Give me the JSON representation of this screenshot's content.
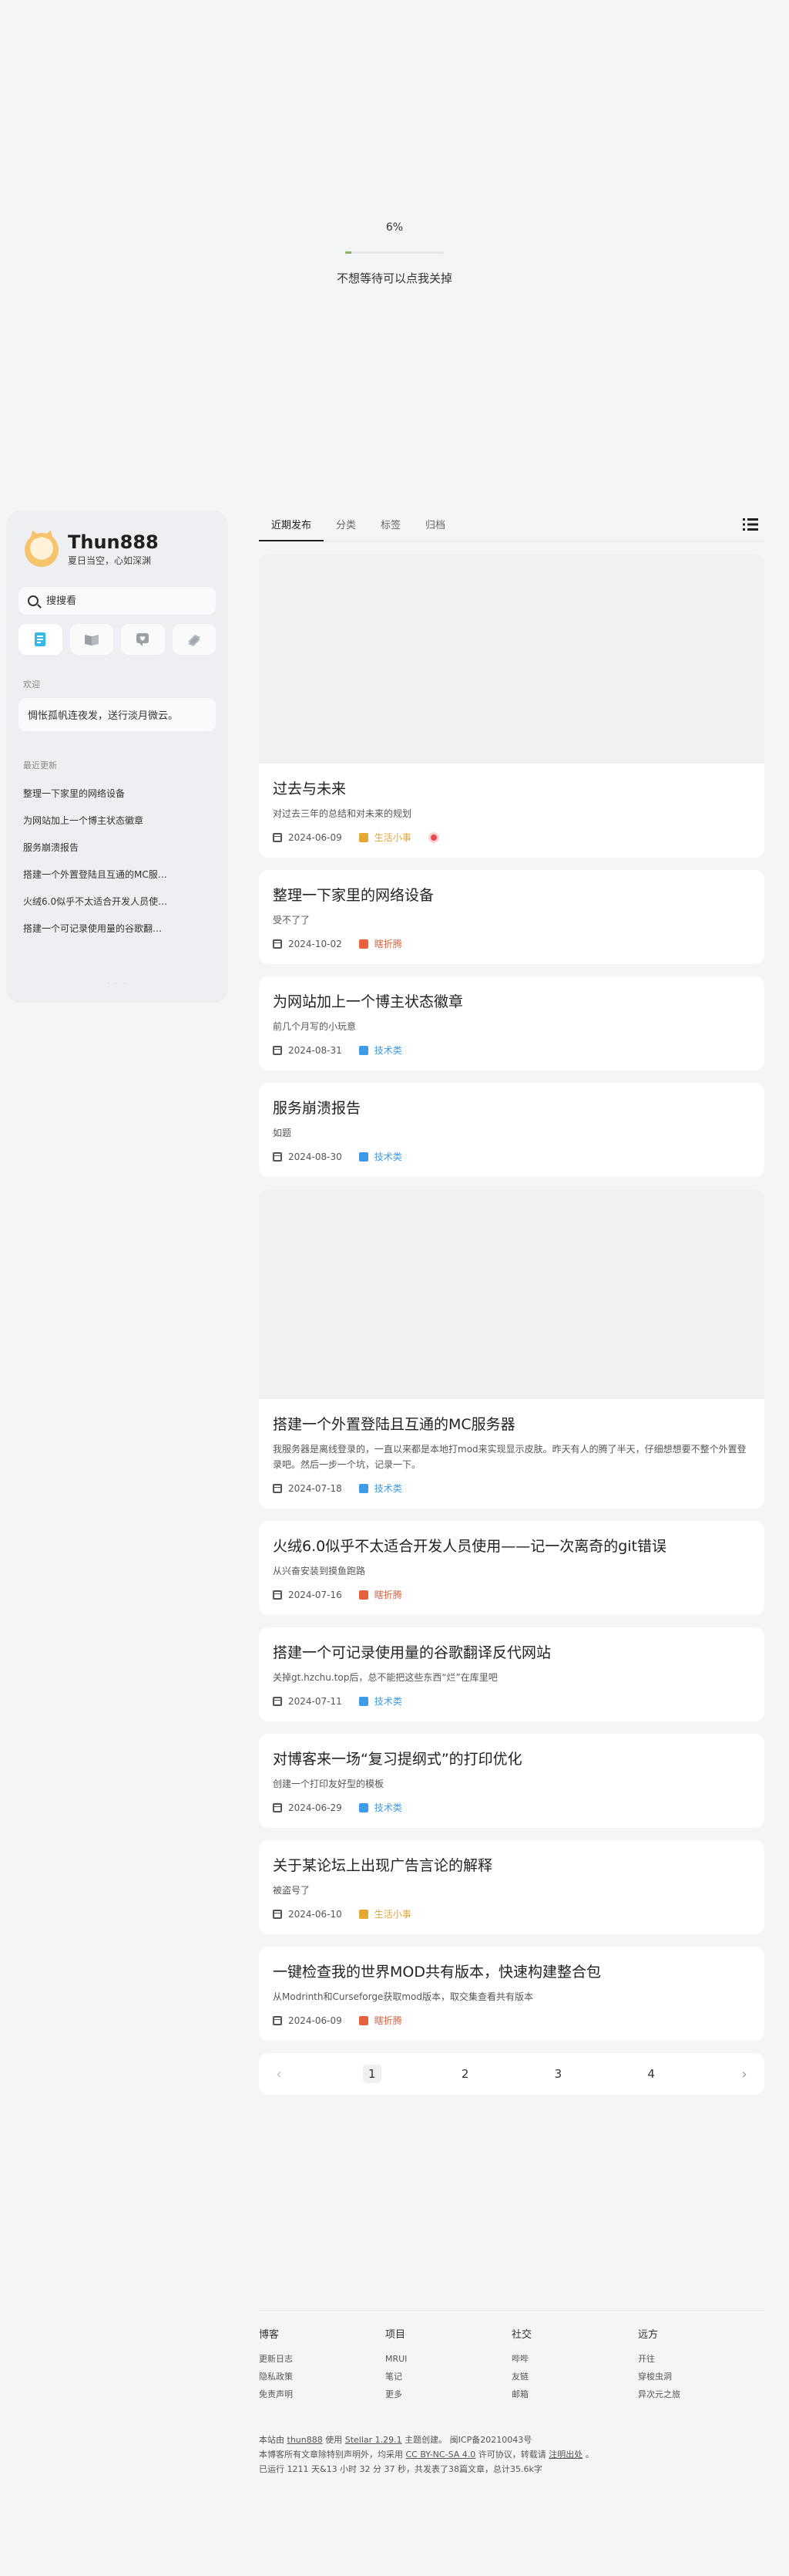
{
  "loader": {
    "percent_text": "6%",
    "progress": 0.06,
    "hint": "不想等待可以点我关掉"
  },
  "sidebar": {
    "title": "Thun888",
    "subtitle": "夏日当空，心如深渊",
    "search_placeholder": "搜搜看",
    "nav_icons": [
      "notebook-icon",
      "book-icon",
      "chat-icon",
      "layers-icon"
    ],
    "welcome_label": "欢迎",
    "welcome_text": "惆怅孤帆连夜发，送行淡月微云。",
    "recent_label": "最近更新",
    "recent": [
      "整理一下家里的网络设备",
      "为网站加上一个博主状态徽章",
      "服务崩溃报告",
      "搭建一个外置登陆且互通的MC服…",
      "火绒6.0似乎不太适合开发人员使…",
      "搭建一个可记录使用量的谷歌翻…"
    ]
  },
  "tabs": [
    "近期发布",
    "分类",
    "标签",
    "归档"
  ],
  "colors": {
    "life": "#e3a833",
    "rant": "#e8603c",
    "tech": "#3d9be9",
    "accent": "#7fb85a"
  },
  "posts": [
    {
      "title": "过去与未来",
      "desc": "对过去三年的总结和对未来的规划",
      "date": "2024-06-09",
      "category": "生活小事",
      "cat_key": "life",
      "cover": true,
      "badge": true
    },
    {
      "title": "整理一下家里的网络设备",
      "desc": "受不了了",
      "date": "2024-10-02",
      "category": "瞎折腾",
      "cat_key": "rant",
      "cover": false
    },
    {
      "title": "为网站加上一个博主状态徽章",
      "desc": "前几个月写的小玩意",
      "date": "2024-08-31",
      "category": "技术类",
      "cat_key": "tech",
      "cover": false
    },
    {
      "title": "服务崩溃报告",
      "desc": "如题",
      "date": "2024-08-30",
      "category": "技术类",
      "cat_key": "tech",
      "cover": false
    },
    {
      "title": "搭建一个外置登陆且互通的MC服务器",
      "desc": "我服务器是离线登录的，一直以来都是本地打mod来实现显示皮肤。昨天有人的腾了半天，仔细想想要不整个外置登录吧。然后一步一个坑，记录一下。",
      "date": "2024-07-18",
      "category": "技术类",
      "cat_key": "tech",
      "cover": true
    },
    {
      "title": "火绒6.0似乎不太适合开发人员使用——记一次离奇的git错误",
      "desc": "从兴奋安装到摸鱼跑路",
      "date": "2024-07-16",
      "category": "瞎折腾",
      "cat_key": "rant",
      "cover": false
    },
    {
      "title": "搭建一个可记录使用量的谷歌翻译反代网站",
      "desc": "关掉gt.hzchu.top后，总不能把这些东西“烂”在库里吧",
      "date": "2024-07-11",
      "category": "技术类",
      "cat_key": "tech",
      "cover": false
    },
    {
      "title": "对博客来一场“复习提纲式”的打印优化",
      "desc": "创建一个打印友好型的模板",
      "date": "2024-06-29",
      "category": "技术类",
      "cat_key": "tech",
      "cover": false
    },
    {
      "title": "关于某论坛上出现广告言论的解释",
      "desc": "被盗号了",
      "date": "2024-06-10",
      "category": "生活小事",
      "cat_key": "life",
      "cover": false
    },
    {
      "title": "一键检查我的世界MOD共有版本，快速构建整合包",
      "desc": "从Modrinth和Curseforge获取mod版本，取交集查看共有版本",
      "date": "2024-06-09",
      "category": "瞎折腾",
      "cat_key": "rant",
      "cover": false
    }
  ],
  "pagination": {
    "pages": [
      "1",
      "2",
      "3",
      "4"
    ],
    "current": "1",
    "prev": "‹",
    "next": "›"
  },
  "footer": {
    "columns": [
      {
        "head": "博客",
        "links": [
          "更新日志",
          "隐私政策",
          "免责声明"
        ]
      },
      {
        "head": "项目",
        "links": [
          "MRUI",
          "笔记",
          "更多"
        ]
      },
      {
        "head": "社交",
        "links": [
          "哔哔",
          "友链",
          "邮箱"
        ]
      },
      {
        "head": "远方",
        "links": [
          "开往",
          "穿梭虫洞",
          "异次元之旅"
        ]
      }
    ],
    "line1_a": "本站由",
    "line1_b": "thun888",
    "line1_c": "使用",
    "line1_d": "Stellar 1.29.1",
    "line1_e": "主题创建。",
    "line1_f": "闽ICP备20210043号",
    "line2_a": "本博客所有文章除特别声明外，均采用",
    "line2_b": "CC BY-NC-SA 4.0",
    "line2_c": "许可协议，转载请",
    "line2_d": "注明出处",
    "line2_e": "。",
    "line3": "已运行 1211 天&13 小时 32 分 37 秒，共发表了38篇文章，总计35.6k字"
  }
}
